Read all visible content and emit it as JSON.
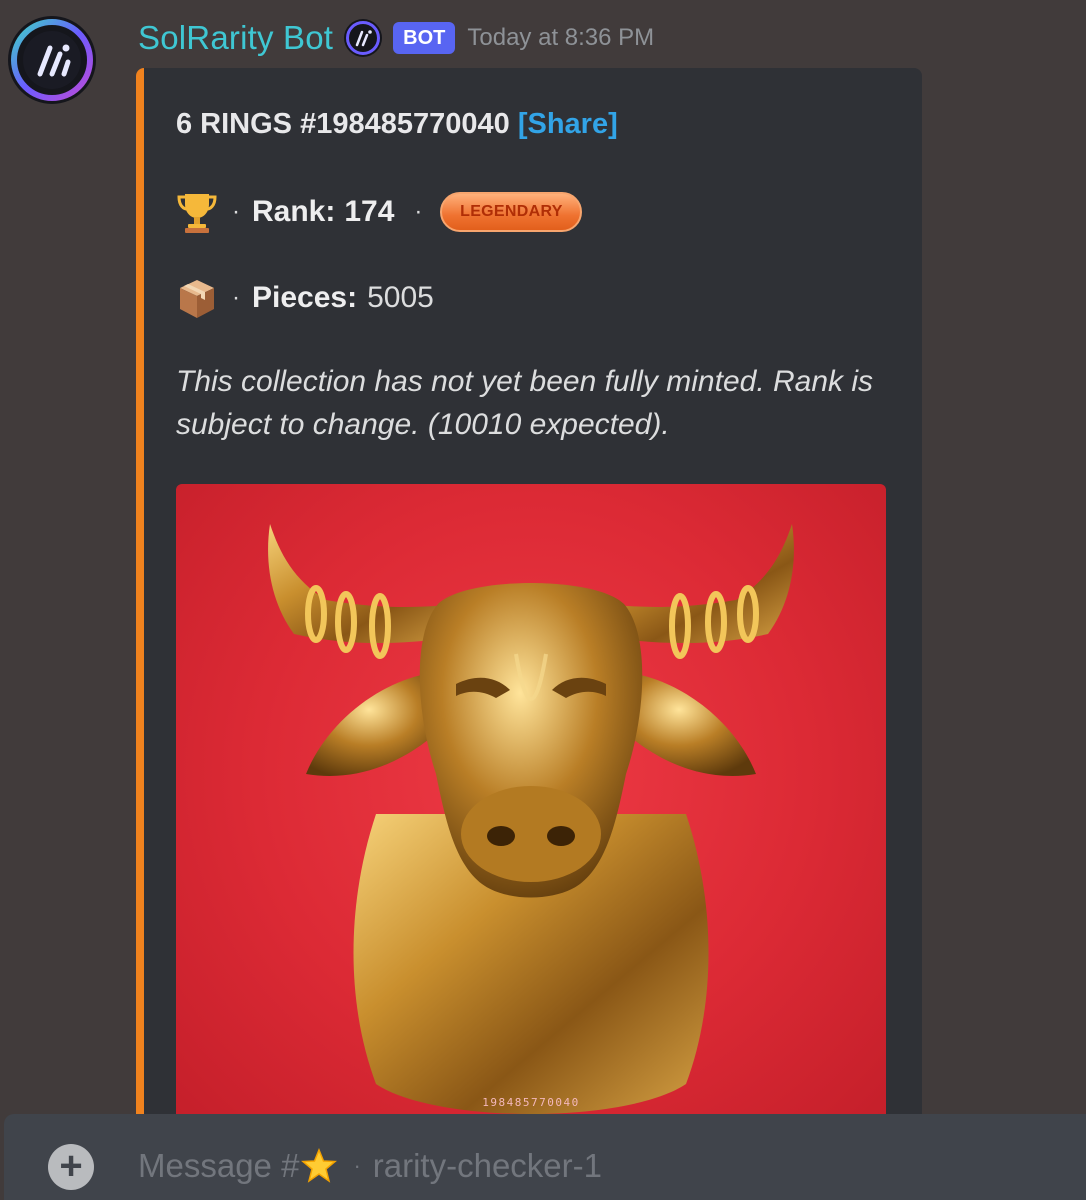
{
  "message": {
    "author": "SolRarity Bot",
    "badge": "BOT",
    "timestamp": "Today at 8:36 PM"
  },
  "embed": {
    "accent_color": "#f0821e",
    "title": "6 RINGS #198485770040",
    "share_label": "[Share]",
    "rank_label": "Rank:",
    "rank_value": "174",
    "rarity_badge": "LEGENDARY",
    "pieces_label": "Pieces:",
    "pieces_value": "5005",
    "description": "This collection has not yet been fully minted. Rank is subject to change. (10010 expected).",
    "image_caption": "198485770040"
  },
  "composer": {
    "placeholder_prefix": "Message #",
    "channel_name": "rarity-checker-1"
  },
  "icons": [
    "bot-avatar-icon",
    "trophy-icon",
    "package-icon",
    "star-icon",
    "plus-icon"
  ]
}
